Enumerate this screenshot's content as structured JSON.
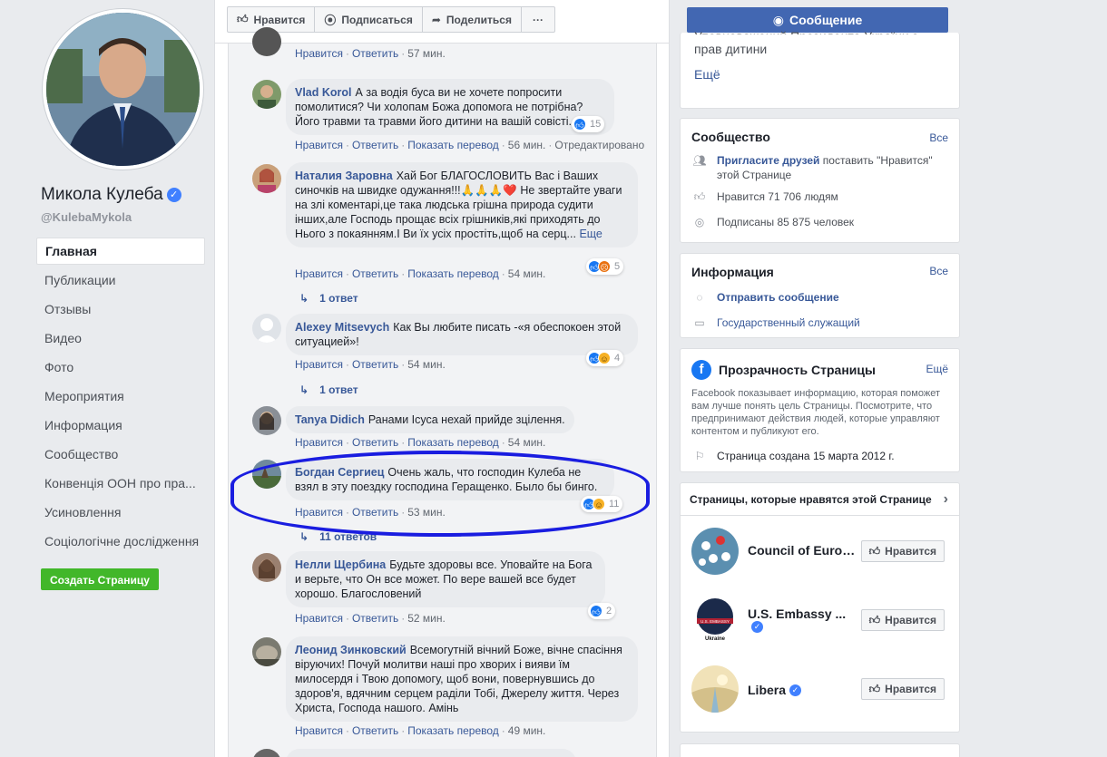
{
  "profile": {
    "name": "Микола Кулеба",
    "handle": "@KulebaMykola",
    "verified_mark": "✓"
  },
  "nav": [
    "Главная",
    "Публикации",
    "Отзывы",
    "Видео",
    "Фото",
    "Мероприятия",
    "Информация",
    "Сообщество",
    "Конвенція ООН про пра...",
    "Усиновлення",
    "Соціологічне дослідження"
  ],
  "create_page": "Создать Страницу",
  "toolbar": {
    "like": "Нравится",
    "follow": "Подписаться",
    "share": "Поделиться",
    "more": "···",
    "message": "Сообщение"
  },
  "actions": {
    "like": "Нравится",
    "reply": "Ответить",
    "translate": "Показать перевод",
    "edited": "Отредактировано",
    "see_more": "Еще"
  },
  "comments": [
    {
      "author": "",
      "text": "",
      "time": "57 мин.",
      "translate": false,
      "edited": false
    },
    {
      "author": "Vlad Korol",
      "text": "А за водія буса ви не хочете попросити помолитися? Чи холопам Божа допомога не потрібна? Його травми та травми його дитини на вашій совісті.",
      "time": "56 мин.",
      "translate": true,
      "edited": true,
      "reactions": "15"
    },
    {
      "author": "Наталия Заровна",
      "text": "Хай Бог БЛАГОСЛОВИТЬ Вас і Ваших синочків на швидке одужання!!!🙏🙏🙏❤️ Не звертайте уваги на злі коментарі,це така людська грішна природа судити інших,але Господь прощає всіх грішників,які приходять до Нього з покаянням.І Ви їх усіх простіть,щоб на серц...",
      "time": "54 мин.",
      "translate": true,
      "reactions": "5",
      "replies": "1 ответ"
    },
    {
      "author": "Alexey Mitsevych",
      "text": "Как Вы любите писать -«я обеспокоен этой ситуацией»!",
      "time": "54 мин.",
      "translate": false,
      "reactions": "4",
      "replies": "1 ответ"
    },
    {
      "author": "Tanya Didich",
      "text": "Ранами Ісуса нехай прийде зцілення.",
      "time": "54 мин.",
      "translate": true
    },
    {
      "author": "Богдан Сергиец",
      "text": "Очень жаль, что господин Кулеба не взял в эту поездку господина Геращенко. Было бы бинго.",
      "time": "53 мин.",
      "translate": false,
      "reactions": "11",
      "replies": "11 ответов"
    },
    {
      "author": "Нелли Щербина",
      "text": "Будьте здоровы все. Уповайте на Бога и верьте, что Он все может. По вере вашей все будет хорошо. Благословений",
      "time": "52 мин.",
      "translate": false,
      "reactions": "2"
    },
    {
      "author": "Леонид Зинковский",
      "text": "Всемогутній вічний Боже, вічне спасіння віруючих! Почуй молитви наші про хворих і вияви їм милосердя і Твою допомогу, щоб вони, повернувшись до здоров'я, вдячним серцем раділи Тобі, Джерелу життя. Через Христа, Господа нашого. Амінь",
      "time": "49 мин.",
      "translate": true
    }
  ],
  "about_snippet": {
    "text_line1": "Уповноважений Президента України з",
    "text_line2": "прав дитини",
    "more": "Ещё"
  },
  "community": {
    "title": "Сообщество",
    "all": "Все",
    "invite_link": "Пригласите друзей",
    "invite_rest": " поставить \"Нравится\" этой Странице",
    "likes": "Нравится 71 706 людям",
    "followers": "Подписаны 85 875 человек"
  },
  "info": {
    "title": "Информация",
    "all": "Все",
    "send_message": "Отправить сообщение",
    "category": "Государственный служащий"
  },
  "transparency": {
    "title": "Прозрачность Страницы",
    "more": "Ещё",
    "desc": "Facebook показывает информацию, которая поможет вам лучше понять цель Страницы. Посмотрите, что предпринимают действия людей, которые управляют контентом и публикуют его.",
    "created": "Страница создана 15 марта 2012 г."
  },
  "liked_pages": {
    "title": "Страницы, которые нравятся этой Странице",
    "like": "Нравится",
    "pages": [
      {
        "name": "Council of Europ...",
        "verified": false
      },
      {
        "name": "U.S. Embassy ...",
        "verified": true,
        "badge": "U.S. EMBASSY",
        "sub": "Ukraine"
      },
      {
        "name": "Libera",
        "verified": true
      }
    ]
  },
  "colors": {
    "fb_blue": "#4267b2",
    "link": "#385898",
    "green": "#42b72a",
    "highlight": "#1a1de0"
  }
}
